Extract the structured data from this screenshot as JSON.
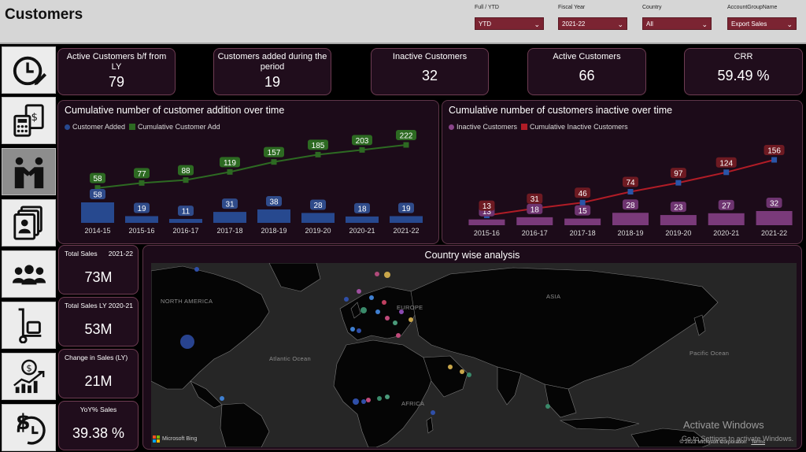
{
  "header": {
    "title": "Customers",
    "filters": [
      {
        "label": "Full / YTD",
        "value": "YTD"
      },
      {
        "label": "Fiscal Year",
        "value": "2021-22"
      },
      {
        "label": "Country",
        "value": "All"
      },
      {
        "label": "AccountGroupName",
        "value": "Export Sales"
      }
    ]
  },
  "nav": {
    "items": [
      {
        "icon": "clock-edit-icon"
      },
      {
        "icon": "calculator-invoice-icon"
      },
      {
        "icon": "handshake-people-icon",
        "active": true
      },
      {
        "icon": "contact-cards-icon"
      },
      {
        "icon": "customers-group-icon"
      },
      {
        "icon": "hand-truck-icon"
      },
      {
        "icon": "growth-chart-icon"
      },
      {
        "icon": "dollar-clock-icon"
      }
    ]
  },
  "kpis": [
    {
      "label": "Active Customers b/f from LY",
      "value": "79"
    },
    {
      "label": "Customers added during the period",
      "value": "19"
    },
    {
      "label": "Inactive Customers",
      "value": "32"
    },
    {
      "label": "Active Customers",
      "value": "66"
    },
    {
      "label": "CRR",
      "value": "59.49 %"
    }
  ],
  "colors": {
    "bar_blue": "#27498f",
    "line_green": "#2d6a22",
    "bar_purple": "#7a3a7a",
    "line_red": "#b01c26",
    "marker_blue": "#2a55a8",
    "accent": "#7b2432"
  },
  "chart_data": [
    {
      "type": "bar",
      "title": "Cumulative number of customer addition over time",
      "categories": [
        "2014-15",
        "2015-16",
        "2016-17",
        "2017-18",
        "2018-19",
        "2019-20",
        "2020-21",
        "2021-22"
      ],
      "series": [
        {
          "name": "Customer Added",
          "type": "bar",
          "values": [
            58,
            19,
            11,
            31,
            38,
            28,
            18,
            19
          ]
        },
        {
          "name": "Cumulative Customer Add",
          "type": "line",
          "values": [
            58,
            77,
            88,
            119,
            157,
            185,
            203,
            222
          ]
        }
      ],
      "legend": "top-left",
      "grid": false
    },
    {
      "type": "bar",
      "title": "Cumulative number of customers inactive over time",
      "categories": [
        "2015-16",
        "2016-17",
        "2017-18",
        "2018-19",
        "2019-20",
        "2020-21",
        "2021-22"
      ],
      "series": [
        {
          "name": "Inactive Customers",
          "type": "bar",
          "values": [
            13,
            18,
            15,
            28,
            23,
            27,
            32
          ]
        },
        {
          "name": "Cumulative Inactive Customers",
          "type": "line",
          "values": [
            13,
            31,
            46,
            74,
            97,
            124,
            156
          ]
        }
      ],
      "legend": "top-left",
      "grid": false
    }
  ],
  "sales_cards": [
    {
      "label": "Total Sales",
      "sub": "2021-22",
      "value": "73M"
    },
    {
      "label": "Total Sales LY",
      "sub": "2020-21",
      "value": "53M"
    },
    {
      "label": "Change in Sales (LY)",
      "sub": "",
      "value": "21M"
    },
    {
      "label": "YoY% Sales",
      "sub": "",
      "value": "39.38 %"
    }
  ],
  "map": {
    "title": "Country wise analysis",
    "labels": [
      "NORTH AMERICA",
      "EUROPE",
      "ASIA",
      "AFRICA",
      "Atlantic Ocean",
      "Pacific Ocean"
    ],
    "provider": "Microsoft Bing",
    "copyright": "© 2023 Microsoft Corporation",
    "terms": "Terms"
  },
  "watermark": {
    "line1": "Activate Windows",
    "line2": "Go to Settings to activate Windows."
  }
}
